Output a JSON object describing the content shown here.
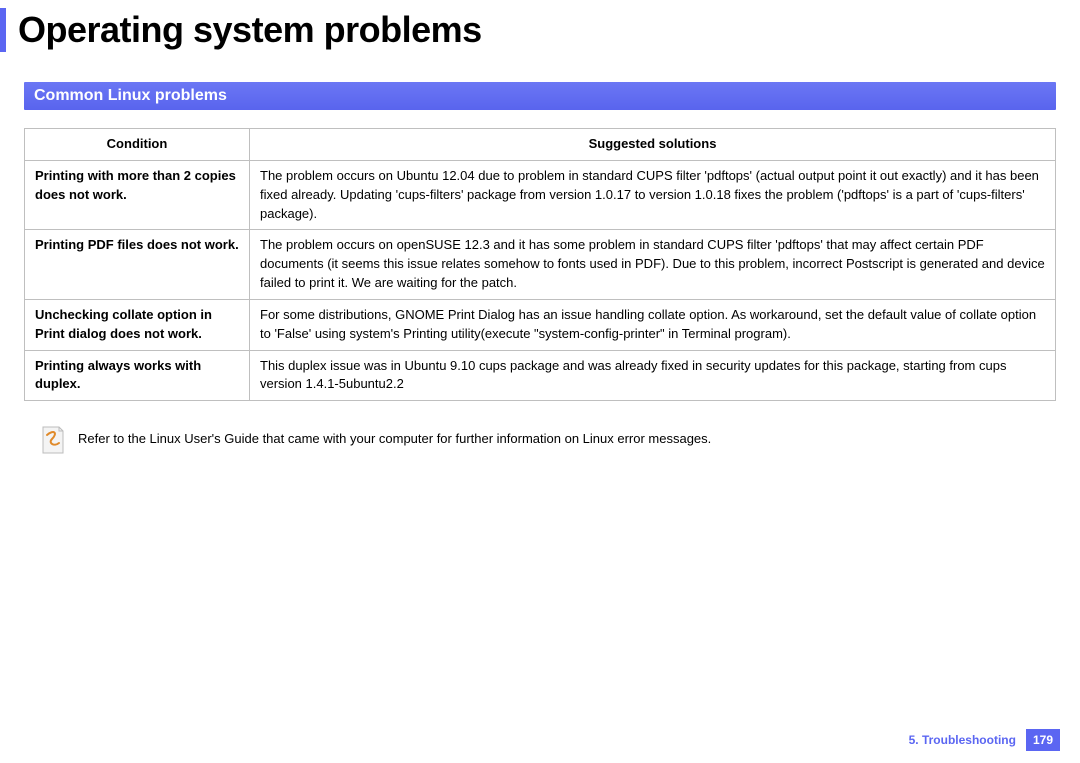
{
  "page": {
    "title": "Operating system problems",
    "section_header": "Common Linux problems"
  },
  "table": {
    "headers": {
      "condition": "Condition",
      "solution": "Suggested solutions"
    },
    "rows": [
      {
        "condition": "Printing with more than 2 copies does not work.",
        "solution": "The problem occurs on Ubuntu 12.04 due to problem in standard CUPS filter 'pdftops' (actual output point it out exactly) and it has been fixed already. Updating 'cups-filters' package from version 1.0.17 to version 1.0.18 fixes the problem ('pdftops' is a part of 'cups-filters' package)."
      },
      {
        "condition": "Printing PDF files does not work.",
        "solution": "The problem occurs on openSUSE 12.3 and it has some problem in standard CUPS filter 'pdftops' that may affect certain PDF documents (it seems this issue relates somehow to fonts used in PDF). Due to this problem, incorrect Postscript is generated and device failed to print it. We are waiting for the patch."
      },
      {
        "condition": "Unchecking collate option in Print dialog does not work.",
        "solution": "For some distributions, GNOME Print Dialog has an issue handling collate option. As workaround, set the default value of collate option to 'False' using system's Printing utility(execute \"system-config-printer\" in Terminal program)."
      },
      {
        "condition": "Printing always works with duplex.",
        "solution": "This duplex issue was in Ubuntu 9.10 cups package and was already fixed in security updates for this package, starting from cups version 1.4.1-5ubuntu2.2"
      }
    ]
  },
  "note": "Refer to the Linux User's Guide that came with your computer for further information on Linux error messages.",
  "footer": {
    "chapter": "5.  Troubleshooting",
    "page": "179"
  }
}
